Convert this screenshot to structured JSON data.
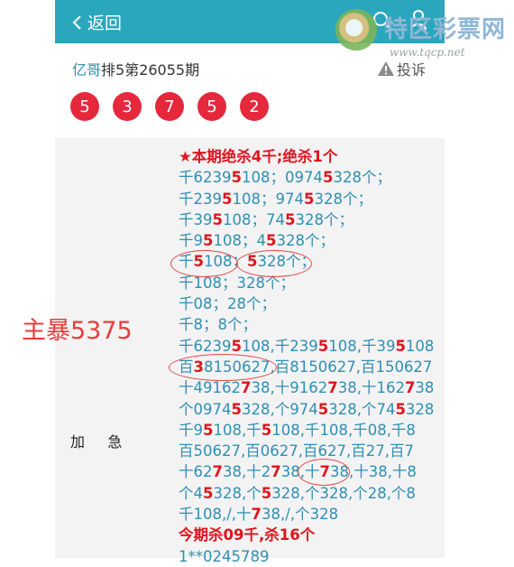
{
  "header": {
    "back_label": "返回",
    "watermark_title": "特区彩票网",
    "watermark_url": "www.tqcp.net"
  },
  "post": {
    "author": "亿哥",
    "title_rest": "排5第26055期",
    "complain_label": "投诉"
  },
  "draw_numbers": [
    "5",
    "3",
    "7",
    "5",
    "2"
  ],
  "side_label": "加     急",
  "side_note": "主暴5375",
  "content_lines": [
    {
      "segments": [
        {
          "t": "★本期绝杀4千;绝杀1个",
          "s": "head"
        }
      ]
    },
    {
      "segments": [
        {
          "t": "千6239",
          "s": "n"
        },
        {
          "t": "5",
          "s": "r"
        },
        {
          "t": "108；0974",
          "s": "n"
        },
        {
          "t": "5",
          "s": "r"
        },
        {
          "t": "328个；",
          "s": "n"
        }
      ]
    },
    {
      "segments": [
        {
          "t": "千239",
          "s": "n"
        },
        {
          "t": "5",
          "s": "r"
        },
        {
          "t": "108；974",
          "s": "n"
        },
        {
          "t": "5",
          "s": "r"
        },
        {
          "t": "328个；",
          "s": "n"
        }
      ]
    },
    {
      "segments": [
        {
          "t": "千39",
          "s": "n"
        },
        {
          "t": "5",
          "s": "r"
        },
        {
          "t": "108；74",
          "s": "n"
        },
        {
          "t": "5",
          "s": "r"
        },
        {
          "t": "328个；",
          "s": "n"
        }
      ]
    },
    {
      "segments": [
        {
          "t": "千9",
          "s": "n"
        },
        {
          "t": "5",
          "s": "r"
        },
        {
          "t": "108；4",
          "s": "n"
        },
        {
          "t": "5",
          "s": "r"
        },
        {
          "t": "328个；",
          "s": "n"
        }
      ]
    },
    {
      "segments": [
        {
          "t": "千",
          "s": "n"
        },
        {
          "t": "5",
          "s": "r"
        },
        {
          "t": "108；",
          "s": "n"
        },
        {
          "t": "5",
          "s": "r"
        },
        {
          "t": "328个；",
          "s": "n"
        }
      ]
    },
    {
      "segments": [
        {
          "t": "千108；328个；",
          "s": "n"
        }
      ]
    },
    {
      "segments": [
        {
          "t": "千08；28个；",
          "s": "n"
        }
      ]
    },
    {
      "segments": [
        {
          "t": "千8；8个；",
          "s": "n"
        }
      ]
    },
    {
      "segments": [
        {
          "t": "千6239",
          "s": "n"
        },
        {
          "t": "5",
          "s": "r"
        },
        {
          "t": "108,千239",
          "s": "n"
        },
        {
          "t": "5",
          "s": "r"
        },
        {
          "t": "108,千39",
          "s": "n"
        },
        {
          "t": "5",
          "s": "r"
        },
        {
          "t": "108",
          "s": "n"
        }
      ]
    },
    {
      "segments": [
        {
          "t": "百",
          "s": "n"
        },
        {
          "t": "3",
          "s": "r"
        },
        {
          "t": "8150627,百8150627,百150627",
          "s": "n"
        }
      ]
    },
    {
      "segments": [
        {
          "t": "十49162",
          "s": "n"
        },
        {
          "t": "7",
          "s": "r"
        },
        {
          "t": "38,十9162",
          "s": "n"
        },
        {
          "t": "7",
          "s": "r"
        },
        {
          "t": "38,十162",
          "s": "n"
        },
        {
          "t": "7",
          "s": "r"
        },
        {
          "t": "38",
          "s": "n"
        }
      ]
    },
    {
      "segments": [
        {
          "t": "个0974",
          "s": "n"
        },
        {
          "t": "5",
          "s": "r"
        },
        {
          "t": "328,个974",
          "s": "n"
        },
        {
          "t": "5",
          "s": "r"
        },
        {
          "t": "328,个74",
          "s": "n"
        },
        {
          "t": "5",
          "s": "r"
        },
        {
          "t": "328",
          "s": "n"
        }
      ]
    },
    {
      "segments": [
        {
          "t": "千9",
          "s": "n"
        },
        {
          "t": "5",
          "s": "r"
        },
        {
          "t": "108,千",
          "s": "n"
        },
        {
          "t": "5",
          "s": "r"
        },
        {
          "t": "108,千108,千08,千8",
          "s": "n"
        }
      ]
    },
    {
      "segments": [
        {
          "t": "百50627,百0627,百627,百27,百7",
          "s": "n"
        }
      ]
    },
    {
      "segments": [
        {
          "t": "十62",
          "s": "n"
        },
        {
          "t": "7",
          "s": "r"
        },
        {
          "t": "38,十2",
          "s": "n"
        },
        {
          "t": "7",
          "s": "r"
        },
        {
          "t": "38,十",
          "s": "n"
        },
        {
          "t": "7",
          "s": "r"
        },
        {
          "t": "38,十38,十8",
          "s": "n"
        }
      ]
    },
    {
      "segments": [
        {
          "t": "个4",
          "s": "n"
        },
        {
          "t": "5",
          "s": "r"
        },
        {
          "t": "328,个",
          "s": "n"
        },
        {
          "t": "5",
          "s": "r"
        },
        {
          "t": "328,个328,个28,个8",
          "s": "n"
        }
      ]
    },
    {
      "segments": [
        {
          "t": "千108,/,十",
          "s": "n"
        },
        {
          "t": "7",
          "s": "r"
        },
        {
          "t": "38,/,个328",
          "s": "n"
        }
      ]
    },
    {
      "segments": [
        {
          "t": "今期杀09千,杀16个",
          "s": "head"
        }
      ]
    },
    {
      "segments": [
        {
          "t": "1**0245789",
          "s": "n"
        }
      ]
    }
  ],
  "colors": {
    "header_bg": "#2aa7bd",
    "ball": "#e6283c",
    "highlight": "#e0141e",
    "content_text": "#2f8fb4",
    "panel_bg": "#f3f3f3"
  }
}
